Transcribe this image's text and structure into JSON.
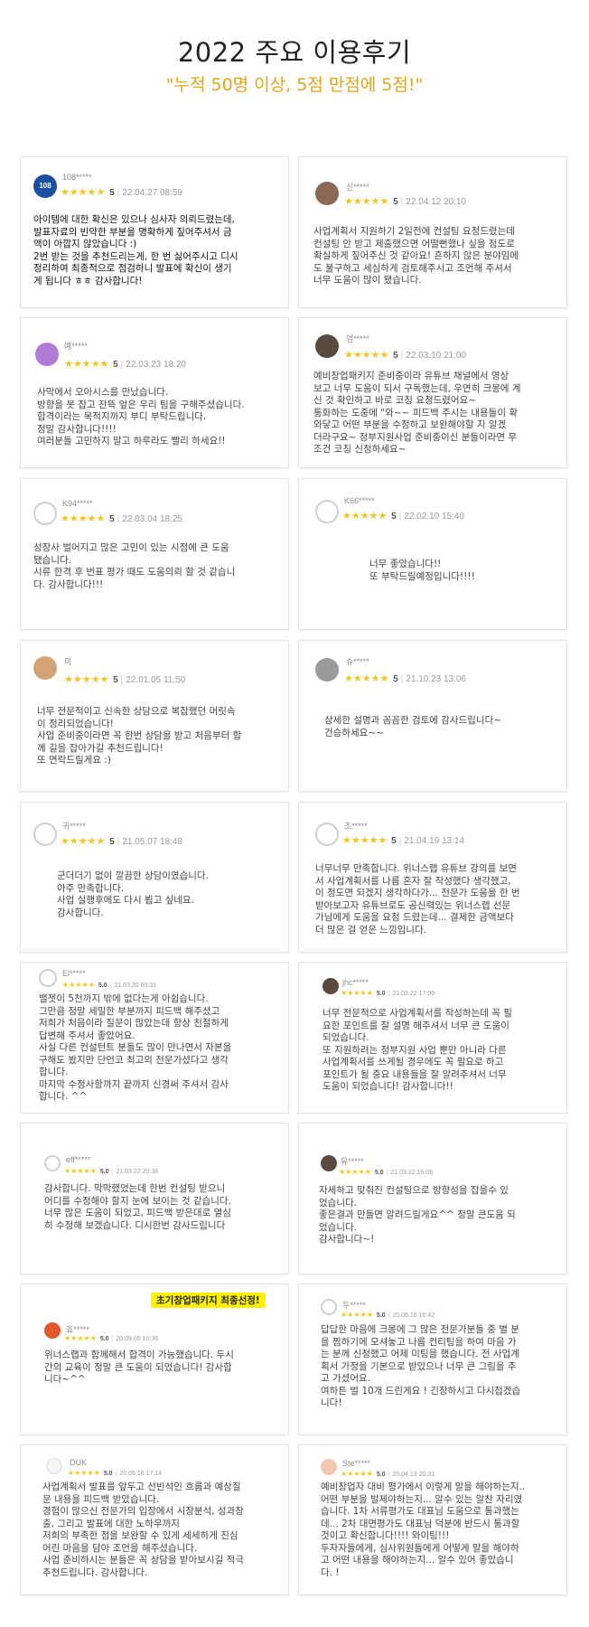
{
  "header": {
    "title": "2022 주요 이용후기",
    "subtitle": "\"누적 50명 이상, 5점 만점에 5점!\""
  },
  "rating_stars": "★★★★★",
  "reviews": [
    {
      "user": "108*****",
      "score": "5",
      "date": "22.04.27 08:59",
      "text": "아이템에 대한 확신은 있으나 심사자 의뢰드렸는데,\n발표자료의 빈약한 부분을 명확하게 짚어주셔서 금\n액이 아깝지 않았습니다 :)\n2번 받는 것을 추천드리는게, 한 번 싫어주시고 디시\n정리하여 최종적으로 점검하니 발표에 확신이 생기\n게 됩니다 ㅎㅎ 감사합니다!"
    },
    {
      "user": "신*****",
      "score": "5",
      "date": "22.04.12 20:10",
      "text": "사업계획서 지원하기 2일전에 컨설팅 요청드렸는데\n컨설팅 안 받고 제출했으면 어떨뻔했나 싶을 정도로\n확실하게 짚어주신 것 같아요! 흔하지 않은 분야임에\n도 불구하고 세심하게 검토해주시고 조언해 주셔서\n너무 도움이 많이 됐습니다."
    },
    {
      "user": "예*****",
      "score": "5",
      "date": "22.03.23 18:20",
      "text": "사막에서 오아시스를 만났습니다.\n방향을 못 잡고 잔뜩 엎은 우리 팀을 구해주셨습니다.\n합격이라는 목적지까지 부디 부탁드립니다.\n정말 감사합니다!!!!\n여러분들 고민하지 말고 하루라도 빨리 하세요!!"
    },
    {
      "user": "엄*****",
      "score": "5",
      "date": "22.03.10 21:00",
      "text": "예비창업패키지 준비중이라 유튜브 채널에서 영상\n보고 너무 도움이 되서 구독했는데, 우연히 크몽에 계\n신 것 확인하고 바로 코칭 요청드렸어요~\n통화하는 도중에 \"와~~ 피드백 주시는 내용들이 확\n와닿고 어떤 부분을 수정하고 보완해야할 지 알겠\n더라구요~ 정부지원사업 준비중이신 분들이라면 무\n조건 코칭 신청하세요~"
    },
    {
      "user": "K94*****",
      "score": "5",
      "date": "22.03.04 18:25",
      "text": "성장사 벌어지고 많은 고민이 있는 시점에 큰 도움\n됐습니다.\n시류 한격 후 번표 평가 때도 도움의뢰 할 것 같습니\n다. 감사합니다!!!"
    },
    {
      "user": "K66*****",
      "score": "5",
      "date": "22.02.10 15:40",
      "text": "너무 좋았습니다!!\n또 부탁드릴예정입니다!!!!"
    },
    {
      "user": "미",
      "score": "5",
      "date": "22.01.05 11:50",
      "text": "너무 전문적이고 신속한 상담으로 복잡했던 머릿속\n이 정리되었습니다!\n사업 준비중이라면 꼭 한번 상담을 받고 처음부터 함\n께 길을 잡아가길 추천드립니다!\n또 연락드릴게요 :)"
    },
    {
      "user": "슈*****",
      "score": "5",
      "date": "21.10.23 13:06",
      "text": "상세한 설명과 꼼꼼한 검토에 감사드립니다~\n건승하세요~~"
    },
    {
      "user": "귀*****",
      "score": "5",
      "date": "21.05.07 18:48",
      "text": "군더더기 없이 깔끔한 상담이였습니다.\n아주 만족합니다.\n사업 실행후에도 다시 뵙고 싶네요.\n감사합니다."
    },
    {
      "user": "초*****",
      "score": "5",
      "date": "21.04.19 13:14",
      "text": "너무너무 만족합니다. 위너스랩 유튜브 강의를 보면\n서 사업계획서를 나름 혼자 잘 작성했다 생각했고,\n이 정도면 되겠지 생각하다가... 전문가 도움을 한 번\n받아보고자 유튜브로도 공신력있는 위너스랩 선문\n가님에게 도움을 요청 드렸는데... 결제한 금액보다\n더 많은 걸 얻은 느낌입니다."
    },
    {
      "user": "El*****",
      "score": "5.0",
      "date": "21.03.20 00:31",
      "text": "밸젯이 5천까지 밖에 없다는게 아쉽습니다.\n그만큼 정말 세밀한 부분까지 피드백 해주셨고\n저희가 처음이라 질문이 많았는데 항상 친절하게\n답변해 주셔서 좋았어요.\n사실 다른 컨설턴트 분들도 많이 만나면서 자본을\n구해도 봤지만 단언코 최고의 전문가셨다고 생각\n합니다.\n마지막 수정사항까지 끝까지 신경써 주셔서 감사\n합니다. ^^"
    },
    {
      "user": "jhc*****",
      "score": "5.0",
      "date": "21.03.22 17:06",
      "text": "너무 전문적으로 사업계획서를 작성하는데 꼭 필\n요한 포인트를 잘 설명 해주셔서 너무 큰 도움이\n되었습니다.\n또 지원하려는 정부지원 사업 뿐만 아니라 다른\n사업계획서를 쓰게될 경우에도 꼭 필요로 하고\n포인트가 될 중요 내용들을 잘 알려주셔서 너무\n도움이 되었습니다! 감사합니다!!"
    },
    {
      "user": "eff*****",
      "score": "5.0",
      "date": "21.03.22 20:38",
      "text": "감사합니다. 막막했었는데 한번 컨설팅 받으니\n어디를 수정해야 할지 눈에 보이는 것 같습니다.\n너무 많은 도움이 되었고, 피드백 받은대로 열심\n히 수정해 보겠습니다. 디시한번 감사드립니다"
    },
    {
      "user": "유*****",
      "score": "5.0",
      "date": "21.03.22 16:09",
      "text": "자세하고 맞춰진 컨설팅으로 방향성을 잡을수 있\n었습니다.\n좋은결과 만들면 알려드릴게요^^ 정말 큰도움 되\n었습니다.\n감사합니다~!"
    },
    {
      "user": "효*****",
      "score": "5.0",
      "date": "20.09.05 10:36",
      "highlight": "초기창업패키지 최종선정!",
      "text": "위너스랩과 함께해서 합격이 가능했습니다. 두시\n간의 교육이 정말 큰 도움이 되었습니다! 감사합\n니다~^^"
    },
    {
      "user": "두*****",
      "score": "5.0",
      "date": "20.06.16 16:42",
      "text": "답답한 마음에 크몽에 그 많은 전문가분들 중 별 분\n을 찜하기에 모셔놓고 나름 컨티팅을 하여 마음 가\n는 분께 신청했고 어제 미팅을 했습니다. 전 사업계\n획서 가정을 기본으로 받았으나 너무 큰 그림을 주\n고 가셨어요.\n여하튼 벌 10개 드린게요 ! 긴장하시고 다시접겠습\n니다!"
    },
    {
      "user": "DUK",
      "score": "5.0",
      "date": "20.05.16 17:14",
      "text": "사업계획서 발표를 앞두고 선빈석인 흐름과 예상질\n문 내용을 피드백 받았습니다.\n경험이 많으신 전문가의 입장에서 시장분석, 성과창\n출, 그리고 발표에 대한 노하우까지\n저희의 부족한 점을 보완할 수 있게 세세하게 진심\n어린 마음을 담아 조언을 해주셨습니다.\n사업 준비하시는 분들은 꼭 상담을 받아보시길 적극\n추천드립니다. 감사합니다."
    },
    {
      "user": "Ste*****",
      "score": "5.0",
      "date": "20.04.13 20:31",
      "text": "예비창업자 대비 평가에서 이렇게 말을 해야하는지..\n어떤 부분을 발제야하는지... 알수 있는 알찬 자리였\n습니다. 1차 서류평가도 대표님 도움으로 통과했는\n데... 2차 대면평가도 대표님 덕분에 반드시 통과할\n것이고 확신합니다!!!! 와이팅!!!\n두자자들에게, 심사위원들에게 어떻게 말을 해야하\n고 어떤 내용을 해야하는지... 알수 있어 좋았습니\n다. !"
    }
  ]
}
